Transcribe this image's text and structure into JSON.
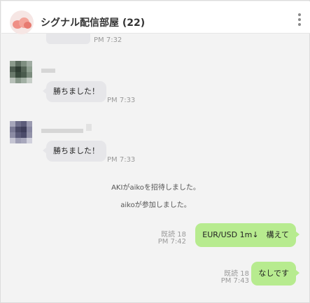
{
  "header": {
    "room_name": "シグナル配信部屋 (22)",
    "menu_icon": "more-vertical-icon"
  },
  "messages": [
    {
      "type": "incoming-partial",
      "time": "PM 7:32"
    },
    {
      "type": "incoming",
      "text": "勝ちました！",
      "time": "PM 7:33"
    },
    {
      "type": "incoming",
      "text": "勝ちました！",
      "time": "PM 7:33"
    },
    {
      "type": "system",
      "text": "AKIがaikoを招待しました。"
    },
    {
      "type": "system",
      "text": "aikoが参加しました。"
    },
    {
      "type": "outgoing",
      "text": "EUR/USD 1m↓　構えて",
      "read": "既読 18",
      "time": "PM 7:42"
    },
    {
      "type": "outgoing",
      "text": "なしです",
      "read": "既読 18",
      "time": "PM 7:43"
    }
  ],
  "colors": {
    "background": "#f3f3f3",
    "incoming_bubble": "#e6e6e9",
    "outgoing_bubble": "#b7eb8f",
    "meta_text": "#9a9a9a"
  }
}
